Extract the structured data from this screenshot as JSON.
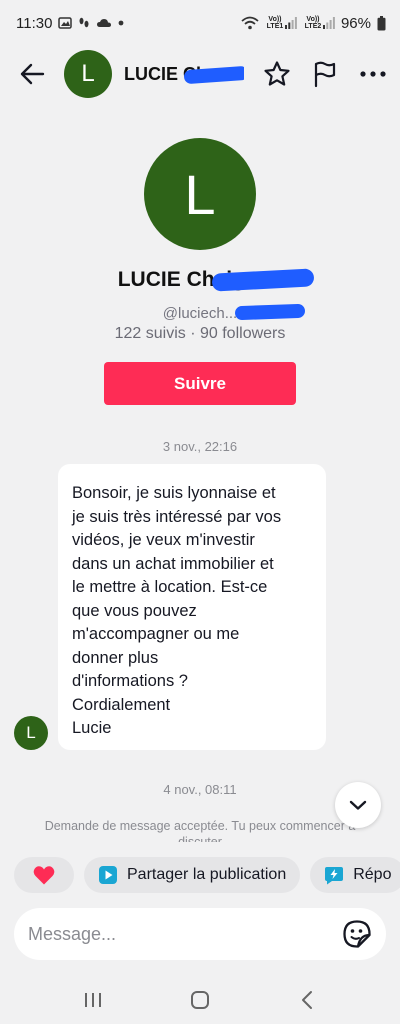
{
  "status_bar": {
    "time": "11:30",
    "sim1": "Vo)) LTE1",
    "sim2": "Vo)) LTE2",
    "battery": "96%"
  },
  "header": {
    "avatar_letter": "L",
    "name": "LUCIE Ch..."
  },
  "profile": {
    "avatar_letter": "L",
    "name": "LUCIE Cheigeou",
    "handle": "@luciech...",
    "stats": "122 suivis · 90 followers",
    "follow_label": "Suivre"
  },
  "chat": {
    "timestamp_1": "3 nov., 22:16",
    "message_lines": [
      "Bonsoir, je suis lyonnaise et",
      "je suis très intéressé par vos",
      "vidéos, je veux m'investir",
      "dans un achat immobilier et",
      "le mettre à location. Est-ce",
      "que vous pouvez",
      "m'accompagner ou me",
      "donner plus",
      "d'informations ?",
      "Cordialement",
      "Lucie"
    ],
    "sender_avatar_letter": "L",
    "timestamp_2": "4 nov., 08:11",
    "system_note": "Demande de message acceptée. Tu peux commencer à discuter"
  },
  "chips": {
    "share_label": "Partager la publication",
    "reply_label": "Répo"
  },
  "input": {
    "placeholder": "Message..."
  },
  "colors": {
    "accent": "#fe2c55",
    "avatar_green": "#2e6318",
    "redaction_blue": "#1f5dff"
  },
  "icons": [
    "back-arrow-icon",
    "star-icon",
    "flag-icon",
    "more-icon",
    "chevron-down-icon",
    "heart-icon",
    "share-play-icon",
    "reply-bolt-icon",
    "sticker-icon",
    "recent-apps-icon",
    "home-icon",
    "back-nav-icon"
  ]
}
